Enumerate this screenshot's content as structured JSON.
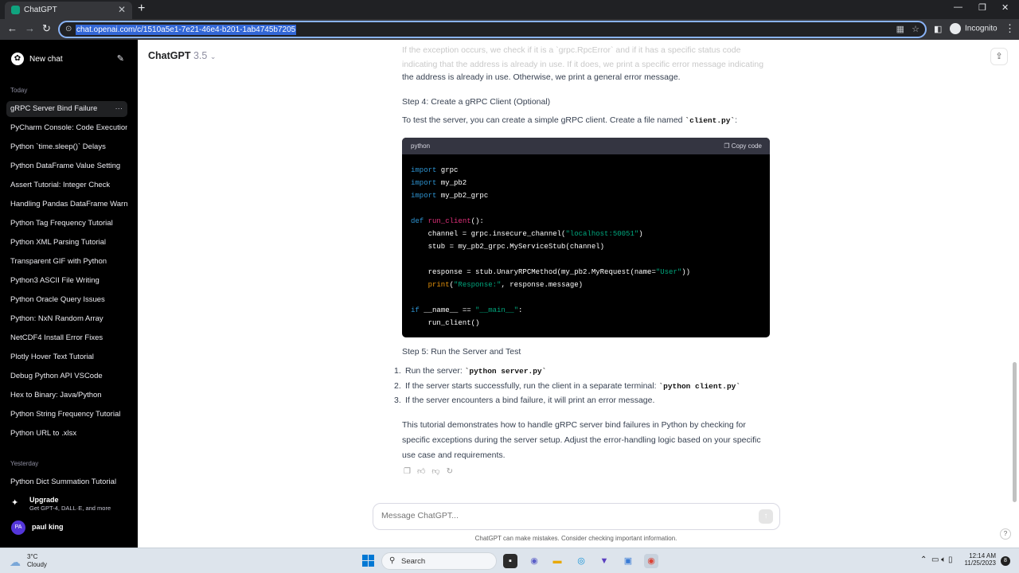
{
  "browser": {
    "tab_title": "ChatGPT",
    "url": "chat.openai.com/c/1510a5e1-7e21-46e4-b201-1ab4745b7205",
    "profile": "Incognito"
  },
  "sidebar": {
    "new_chat": "New chat",
    "section_today": "Today",
    "today_items": [
      "gRPC Server Bind Failure",
      "PyCharm Console: Code Execution",
      "Python `time.sleep()` Delays",
      "Python DataFrame Value Setting",
      "Assert Tutorial: Integer Check",
      "Handling Pandas DataFrame Warnings",
      "Python Tag Frequency Tutorial",
      "Python XML Parsing Tutorial",
      "Transparent GIF with Python",
      "Python3 ASCII File Writing",
      "Python Oracle Query Issues",
      "Python: NxN Random Array",
      "NetCDF4 Install Error Fixes",
      "Plotly Hover Text Tutorial",
      "Debug Python API VSCode",
      "Hex to Binary: Java/Python",
      "Python String Frequency Tutorial",
      "Python URL to .xlsx"
    ],
    "section_yesterday": "Yesterday",
    "yesterday_items": [
      "Python Dict Summation Tutorial"
    ],
    "upgrade_title": "Upgrade",
    "upgrade_sub": "Get GPT-4, DALL·E, and more",
    "user_initials": "PA",
    "user_name": "paul king"
  },
  "header": {
    "model": "ChatGPT",
    "version": "3.5"
  },
  "content": {
    "faded_text": "If the exception occurs, we check if it is a `grpc.RpcError` and if it has a specific status code indicating that the address is already in use. If it does, we print a specific error message indicating that",
    "para_end": "the address is already in use. Otherwise, we print a general error message.",
    "step4": "Step 4: Create a gRPC Client (Optional)",
    "step4_text": "To test the server, you can create a simple gRPC client. Create a file named ",
    "step4_file": "`client.py`",
    "step4_tail": ":",
    "code_lang": "python",
    "copy_code": "Copy code",
    "step5": "Step 5: Run the Server and Test",
    "list": [
      {
        "num": "1.",
        "text": "Run the server: ",
        "code": "`python server.py`"
      },
      {
        "num": "2.",
        "text": "If the server starts successfully, run the client in a separate terminal: ",
        "code": "`python client.py`"
      },
      {
        "num": "3.",
        "text": "If the server encounters a bind failure, it will print an error message.",
        "code": ""
      }
    ],
    "summary_1": "This tutorial demonstrates how to handle gRPC server bind failures in Python by checking for",
    "summary_2": "specific exceptions during the server setup. Adjust the error-handling logic based on your specific",
    "summary_3": "use case and requirements."
  },
  "composer": {
    "placeholder": "Message ChatGPT...",
    "disclaimer": "ChatGPT can make mistakes. Consider checking important information."
  },
  "taskbar": {
    "temp": "3°C",
    "weather": "Cloudy",
    "search": "Search",
    "time": "12:14 AM",
    "date": "11/25/2023",
    "notifications": "8"
  },
  "colors": {
    "sidebar_bg": "#000000",
    "code_bg": "#000000",
    "keyword": "#2e95d3",
    "function": "#df3079",
    "string": "#00a67d",
    "builtin": "#e9950c"
  }
}
